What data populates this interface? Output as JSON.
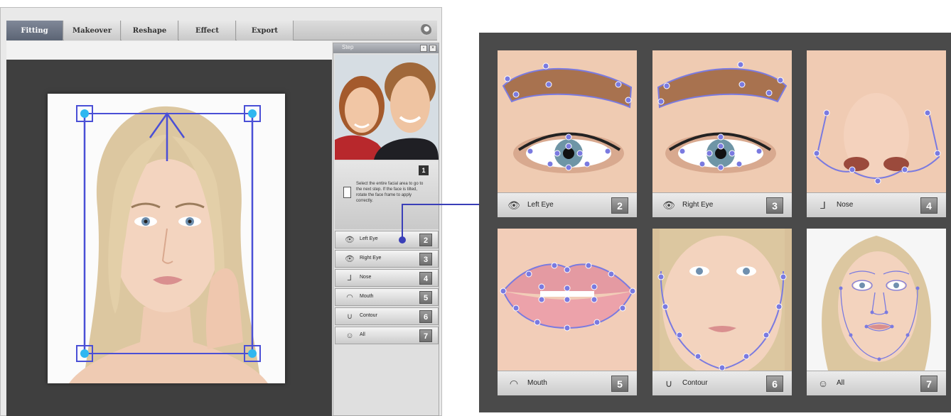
{
  "tabs": [
    {
      "label": "Fitting",
      "active": true
    },
    {
      "label": "Makeover",
      "active": false
    },
    {
      "label": "Reshape",
      "active": false
    },
    {
      "label": "Effect",
      "active": false
    },
    {
      "label": "Export",
      "active": false
    }
  ],
  "step_panel": {
    "title": "Step",
    "step_badge": "1",
    "instruction": "Select the entire facial area to go to the next step. If the face is tilted, rotate the face frame to apply correctly.",
    "items": [
      {
        "label": "Left Eye",
        "num": "2",
        "icon": "eye-icon"
      },
      {
        "label": "Right Eye",
        "num": "3",
        "icon": "eye-icon"
      },
      {
        "label": "Nose",
        "num": "4",
        "icon": "nose-icon"
      },
      {
        "label": "Mouth",
        "num": "5",
        "icon": "mouth-icon"
      },
      {
        "label": "Contour",
        "num": "6",
        "icon": "contour-icon"
      },
      {
        "label": "All",
        "num": "7",
        "icon": "face-icon"
      }
    ]
  },
  "cards": [
    {
      "label": "Left Eye",
      "num": "2",
      "icon": "eye-icon"
    },
    {
      "label": "Right Eye",
      "num": "3",
      "icon": "eye-icon"
    },
    {
      "label": "Nose",
      "num": "4",
      "icon": "nose-icon"
    },
    {
      "label": "Mouth",
      "num": "5",
      "icon": "mouth-icon"
    },
    {
      "label": "Contour",
      "num": "6",
      "icon": "contour-icon"
    },
    {
      "label": "All",
      "num": "7",
      "icon": "face-icon"
    }
  ],
  "colors": {
    "accent": "#4a4fd6",
    "handle": "#2fb7f0",
    "skin": "#f0cdb6",
    "hair": "#d9c39a",
    "panel_dark": "#4a4a4a"
  }
}
